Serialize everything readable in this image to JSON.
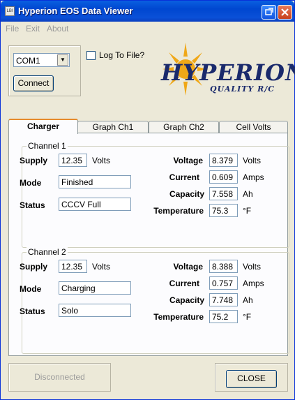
{
  "window": {
    "title": "Hyperion EOS Data Viewer",
    "icon_label": "LBI"
  },
  "menu": {
    "file": "File",
    "exit": "Exit",
    "about": "About"
  },
  "connection": {
    "port_value": "COM1",
    "connect_label": "Connect",
    "log_label": "Log To File?",
    "status_text": "Disconnected"
  },
  "logo": {
    "word": "HYPERION",
    "tagline": "QUALITY R/C"
  },
  "tabs": [
    "Charger",
    "Graph Ch1",
    "Graph Ch2",
    "Cell Volts"
  ],
  "labels": {
    "supply": "Supply",
    "mode": "Mode",
    "status": "Status",
    "voltage": "Voltage",
    "current": "Current",
    "capacity": "Capacity",
    "temperature": "Temperature",
    "volts_unit": "Volts",
    "amps_unit": "Amps",
    "ah_unit": "Ah",
    "temp_unit": "°F"
  },
  "channel1": {
    "title": "Channel 1",
    "supply": "12.35",
    "mode": "Finished",
    "status": "CCCV Full",
    "voltage": "8.379",
    "current": "0.609",
    "capacity": "7.558",
    "temperature": "75.3"
  },
  "channel2": {
    "title": "Channel 2",
    "supply": "12.35",
    "mode": "Charging",
    "status": "Solo",
    "voltage": "8.388",
    "current": "0.757",
    "capacity": "7.748",
    "temperature": "75.2"
  },
  "close_label": "CLOSE",
  "colors": {
    "titlebar": "#0a50d8",
    "logo_text": "#1a2a6c",
    "sun": "#f0a818",
    "tab_accent": "#e68b2c"
  }
}
